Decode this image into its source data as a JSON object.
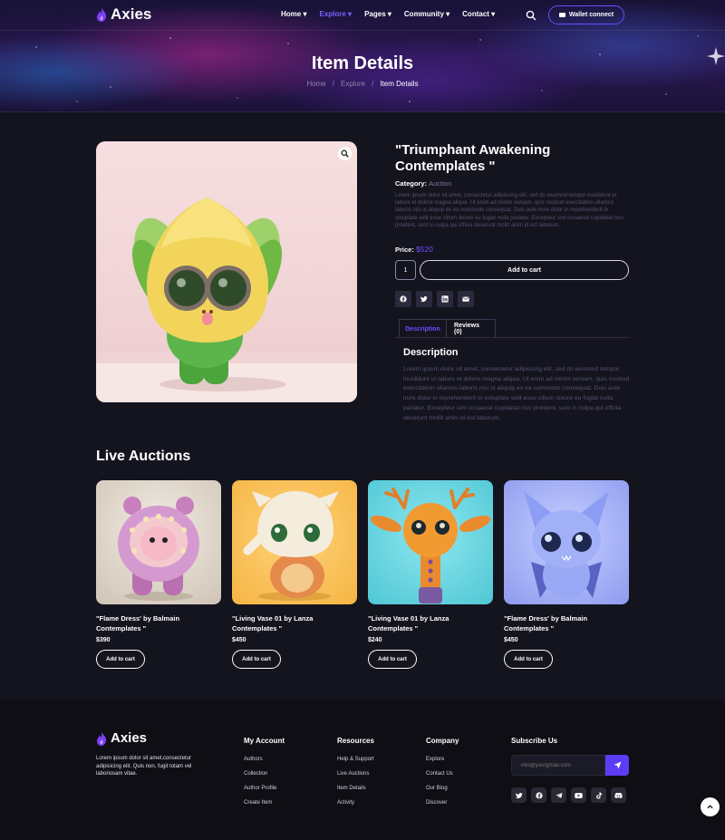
{
  "header": {
    "brand": "Axies",
    "nav": [
      {
        "label": "Home",
        "active": false
      },
      {
        "label": "Explore",
        "active": true
      },
      {
        "label": "Pages",
        "active": false
      },
      {
        "label": "Community",
        "active": false
      },
      {
        "label": "Contact",
        "active": false
      }
    ],
    "wallet_label": "Wallet connect"
  },
  "hero": {
    "title": "Item Details",
    "breadcrumb": [
      "Home",
      "Explore",
      "Item Details"
    ]
  },
  "item": {
    "title": "\"Triumphant Awakening Contemplates \"",
    "category_label": "Category:",
    "category_value": "Auction",
    "summary": "Lorem ipsum dolor sit amet, consectetur adipiscing elit, sed do eiusmod tempor incididunt ut labore et dolore magna aliqua. Ut enim ad minim veniam, quis nostrud exercitation ullamco laboris nisi ut aliquip ex ea commodo consequat. Duis aute irure dolor in reprehenderit in voluptate velit esse cillum dolore eu fugiat nulla pariatur. Excepteur sint occaecat cupidatat non proident, sunt in culpa qui officia deserunt mollit anim id est laborum.",
    "price_label": "Price:",
    "price_value": "$520",
    "quantity": "1",
    "add_to_cart": "Add to cart",
    "share_icons": [
      "facebook-icon",
      "twitter-icon",
      "linkedin-icon",
      "email-icon"
    ],
    "tabs": [
      {
        "label": "Description",
        "active": true
      },
      {
        "label": "Reviews (0)",
        "active": false
      }
    ],
    "description_heading": "Description",
    "description_text": "Lorem ipsum dolor sit amet, consectetur adipiscing elit, sed do eiusmod tempor incididunt ut labore et dolore magna aliqua. Ut enim ad minim veniam, quis nostrud exercitation ullamco laboris nisi ut aliquip ex ea commodo consequat. Duis aute irure dolor in reprehenderit in voluptate velit esse cillum dolore eu fugiat nulla pariatur. Excepteur sint occaecat cupidatat non proident, sunt in culpa qui officia deserunt mollit anim id est laborum."
  },
  "live": {
    "heading": "Live Auctions",
    "cards": [
      {
        "name": "\"Flame Dress' by Balmain Contemplates \"",
        "price": "$390",
        "button": "Add to cart"
      },
      {
        "name": "\"Living Vase 01 by Lanza Contemplates \"",
        "price": "$450",
        "button": "Add to cart"
      },
      {
        "name": "\"Living Vase 01 by Lanza Contemplates \"",
        "price": "$240",
        "button": "Add to cart"
      },
      {
        "name": "\"Flame Dress' by Balmain Contemplates \"",
        "price": "$450",
        "button": "Add to cart"
      }
    ]
  },
  "footer": {
    "brand": "Axies",
    "description": "Lorem ipsum dolor sit amet,consectetur adipisicing elit. Quis non, fugit totam vel laboriosam vitae.",
    "columns": [
      {
        "title": "My Account",
        "links": [
          "Authors",
          "Collection",
          "Author Profile",
          "Create Item"
        ]
      },
      {
        "title": "Resources",
        "links": [
          "Help & Support",
          "Live Auctions",
          "Item Details",
          "Activity"
        ]
      },
      {
        "title": "Company",
        "links": [
          "Explore",
          "Contact Us",
          "Our Blog",
          "Discover"
        ]
      }
    ],
    "subscribe_title": "Subscribe Us",
    "email_placeholder": "info@yourgmail.com",
    "social_icons": [
      "twitter-icon",
      "facebook-icon",
      "telegram-icon",
      "youtube-icon",
      "tiktok-icon",
      "discord-icon"
    ]
  },
  "colors": {
    "accent": "#6b4dff",
    "background": "#14141f",
    "footer": "#0e0e14"
  }
}
